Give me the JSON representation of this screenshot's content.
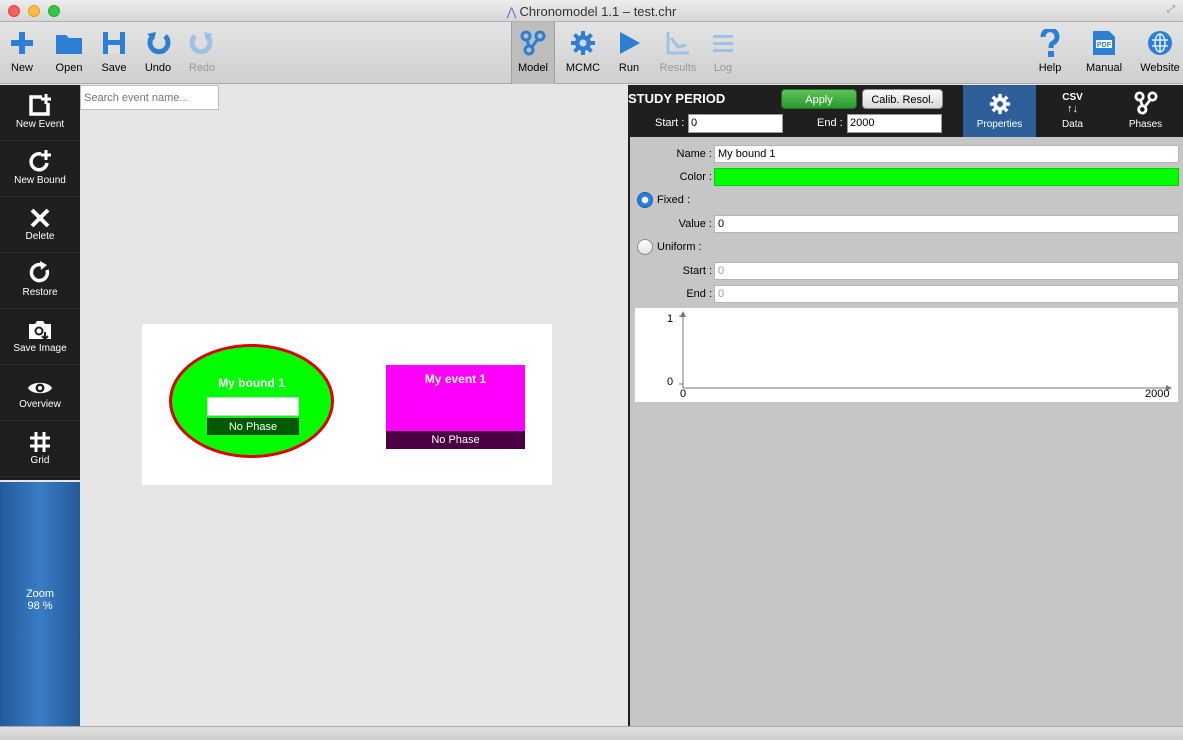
{
  "window": {
    "title": "Chronomodel 1.1 – test.chr"
  },
  "toolbar": {
    "left": [
      {
        "label": "New",
        "icon": "plus-icon"
      },
      {
        "label": "Open",
        "icon": "folder-icon"
      },
      {
        "label": "Save",
        "icon": "floppy-icon"
      },
      {
        "label": "Undo",
        "icon": "undo-icon"
      },
      {
        "label": "Redo",
        "icon": "redo-icon"
      }
    ],
    "center": [
      {
        "label": "Model",
        "icon": "model-icon"
      },
      {
        "label": "MCMC",
        "icon": "gear-icon"
      },
      {
        "label": "Run",
        "icon": "play-icon"
      },
      {
        "label": "Results",
        "icon": "results-chart-icon"
      },
      {
        "label": "Log",
        "icon": "log-lines-icon"
      }
    ],
    "right": [
      {
        "label": "Help",
        "icon": "question-icon"
      },
      {
        "label": "Manual",
        "icon": "pdf-icon"
      },
      {
        "label": "Website",
        "icon": "globe-icon"
      }
    ]
  },
  "left_tools": [
    {
      "label": "New Event",
      "icon": "new-event-icon"
    },
    {
      "label": "New Bound",
      "icon": "new-bound-icon"
    },
    {
      "label": "Delete",
      "icon": "delete-x-icon"
    },
    {
      "label": "Restore",
      "icon": "restore-icon"
    },
    {
      "label": "Save Image",
      "icon": "camera-icon"
    },
    {
      "label": "Overview",
      "icon": "eye-icon"
    },
    {
      "label": "Grid",
      "icon": "grid-icon"
    }
  ],
  "zoom": {
    "label": "Zoom",
    "value": "98 %"
  },
  "search": {
    "placeholder": "Search event name..."
  },
  "scene": {
    "bound": {
      "name": "My bound 1",
      "phase": "No Phase",
      "color": "#00ff00",
      "border_color": "#e00000"
    },
    "event": {
      "name": "My event 1",
      "phase": "No Phase",
      "color": "#ff00ff"
    }
  },
  "study_period": {
    "title": "STUDY PERIOD",
    "apply_label": "Apply",
    "calib_label": "Calib. Resol.",
    "start_label": "Start :",
    "start_value": "0",
    "end_label": "End :",
    "end_value": "2000"
  },
  "tabs": [
    {
      "label": "Properties",
      "icon": "gear-icon",
      "active": true
    },
    {
      "label": "Data",
      "icon": "csv-icon",
      "icon_text": "CSV",
      "active": false
    },
    {
      "label": "Phases",
      "icon": "phases-icon",
      "active": false
    }
  ],
  "properties": {
    "name_label": "Name :",
    "name_value": "My bound 1",
    "color_label": "Color :",
    "color_value": "#00ff00",
    "fixed_label": "Fixed :",
    "value_label": "Value :",
    "value_value": "0",
    "uniform_label": "Uniform :",
    "start_label": "Start :",
    "start_value": "0",
    "end_label": "End :",
    "end_value": "0",
    "selected_mode": "fixed"
  },
  "plot": {
    "y_top": "1",
    "y_bottom": "0",
    "x_left": "0",
    "x_right": "2000"
  }
}
